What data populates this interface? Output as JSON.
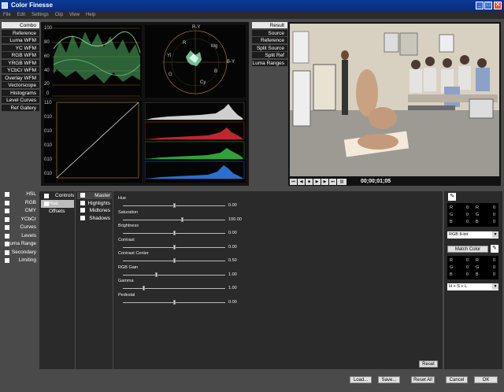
{
  "window": {
    "title": "Color Finesse"
  },
  "menu": [
    "File",
    "Edit",
    "Settings",
    "Clip",
    "View",
    "Help"
  ],
  "scope_tabs": [
    "Combo",
    "Reference",
    "Luma WFM",
    "YC WFM",
    "RGB WFM",
    "YRGB WFM",
    "YCbCr WFM",
    "Overlay WFM",
    "Vectorscope",
    "Histograms",
    "Level Curves",
    "Ref Gallery"
  ],
  "scopes": {
    "waveform_ticks": [
      "100",
      "80",
      "60",
      "40",
      "20",
      "0"
    ],
    "curve_ticks": [
      "110",
      "010",
      "010",
      "010",
      "010",
      "010"
    ],
    "vector_labels": [
      "R",
      "Mg",
      "B",
      "Cy",
      "G",
      "Yl",
      "R-Y",
      "B-Y",
      "YI"
    ]
  },
  "result_tabs": [
    "Result",
    "Source",
    "Reference",
    "Split Source",
    "Split Ref",
    "Luma Ranges"
  ],
  "transport": {
    "timecode": "00;00;01;05"
  },
  "categories": [
    "HSL",
    "RGB",
    "CMY",
    "YCbCr",
    "Curves",
    "Levels",
    "Luma Range",
    "Secondary",
    "Limiting"
  ],
  "control_tabs": [
    "Controls",
    "Hue Offsets"
  ],
  "range_tabs": [
    "Master",
    "Highlights",
    "Midtones",
    "Shadows"
  ],
  "sliders": [
    {
      "label": "Hue",
      "value": "0.00",
      "pos": 0.5
    },
    {
      "label": "Saturation",
      "value": "100.00",
      "pos": 0.58
    },
    {
      "label": "Brightness",
      "value": "0.00",
      "pos": 0.5
    },
    {
      "label": "Contrast",
      "value": "0.00",
      "pos": 0.5
    },
    {
      "label": "Contrast Center",
      "value": "0.50",
      "pos": 0.5
    },
    {
      "label": "RGB Gain",
      "value": "1.00",
      "pos": 0.33
    },
    {
      "label": "Gamma",
      "value": "1.00",
      "pos": 0.2
    },
    {
      "label": "Pedestal",
      "value": "0.00",
      "pos": 0.5
    }
  ],
  "reset_label": "Reset",
  "info": {
    "rgb1": [
      [
        "R",
        "0",
        "R",
        "0"
      ],
      [
        "G",
        "0",
        "G",
        "0"
      ],
      [
        "B",
        "0",
        "B",
        "0"
      ]
    ],
    "select1": "RGB 8-bit",
    "match_label": "Match Color",
    "rgb2": [
      [
        "R",
        "0",
        "R",
        "0"
      ],
      [
        "G",
        "0",
        "G",
        "0"
      ],
      [
        "B",
        "0",
        "B",
        "0"
      ]
    ],
    "select2": "H + S + L"
  },
  "footer": {
    "load": "Load...",
    "save": "Save...",
    "reset_all": "Reset All",
    "cancel": "Cancel",
    "ok": "OK"
  }
}
